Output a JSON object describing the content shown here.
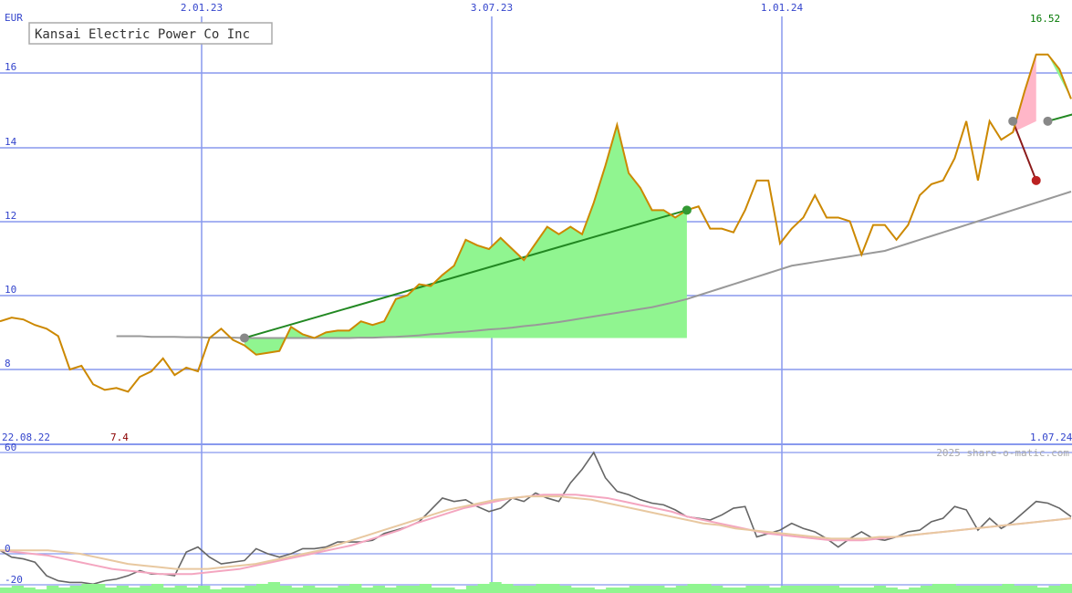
{
  "chart_data": [
    {
      "type": "line",
      "title": "Kansai Electric Power Co Inc",
      "currency_label": "EUR",
      "last_value_label": "16.52",
      "min_value_label": "7.4",
      "start_date_label": "22.08.22",
      "end_date_label": "1.07.24",
      "x_tick_labels": [
        "2.01.23",
        "3.07.23",
        "1.01.24"
      ],
      "y_tick_labels": [
        "16",
        "14",
        "12",
        "10",
        "8"
      ],
      "ylim": [
        7.0,
        16.8
      ],
      "grid": true,
      "colors": {
        "price": "#cc8800",
        "moving_average": "#999999",
        "trend_line": "#228822",
        "gain_fill": "#90f590",
        "loss_fill": "#ffb6c8",
        "grid": "#8899ee"
      },
      "series": [
        {
          "values": [
            9.3,
            9.4,
            9.35,
            9.2,
            9.1,
            8.9,
            8.0,
            8.1,
            7.6,
            7.45,
            7.5,
            7.4,
            7.8,
            7.95,
            8.3,
            7.85,
            8.05,
            7.95,
            8.85,
            9.1,
            8.8,
            8.65,
            8.4,
            8.45,
            8.5,
            9.15,
            8.95,
            8.85,
            9.0,
            9.05,
            9.05,
            9.3,
            9.2,
            9.3,
            9.9,
            10.0,
            10.3,
            10.25,
            10.55,
            10.8,
            11.5,
            11.35,
            11.25,
            11.55,
            11.25,
            10.95,
            11.4,
            11.85,
            11.65,
            11.85,
            11.65,
            12.5,
            13.5,
            14.6,
            13.3,
            12.9,
            12.3,
            12.3,
            12.1,
            12.3,
            12.4,
            11.8,
            11.8,
            11.7,
            12.3,
            13.1,
            13.1,
            11.4,
            11.8,
            12.1,
            12.7,
            12.1,
            12.1,
            12.0,
            11.1,
            11.9,
            11.9,
            11.5,
            11.9,
            12.7,
            13.0,
            13.1,
            13.7,
            14.7,
            13.1,
            14.7,
            14.2,
            14.4,
            15.5,
            16.5,
            16.5,
            16.1,
            15.3
          ]
        },
        {
          "values": [
            8.9,
            8.9,
            8.9,
            8.88,
            8.88,
            8.88,
            8.87,
            8.87,
            8.86,
            8.86,
            8.86,
            8.85,
            8.85,
            8.85,
            8.85,
            8.85,
            8.85,
            8.85,
            8.85,
            8.85,
            8.85,
            8.86,
            8.86,
            8.87,
            8.88,
            8.9,
            8.92,
            8.95,
            8.97,
            9.0,
            9.02,
            9.05,
            9.08,
            9.1,
            9.13,
            9.17,
            9.2,
            9.24,
            9.28,
            9.33,
            9.38,
            9.43,
            9.48,
            9.53,
            9.58,
            9.63,
            9.68,
            9.75,
            9.82,
            9.9,
            10.0,
            10.1,
            10.2,
            10.3,
            10.4,
            10.5,
            10.6,
            10.7,
            10.8,
            10.85,
            10.9,
            10.95,
            11.0,
            11.05,
            11.1,
            11.15,
            11.2,
            11.3,
            11.4,
            11.5,
            11.6,
            11.7,
            11.8,
            11.9,
            12.0,
            12.1,
            12.2,
            12.3,
            12.4,
            12.5,
            12.6,
            12.7,
            12.8
          ]
        }
      ],
      "trend_segments": [
        {
          "from": [
            21,
            8.85
          ],
          "to": [
            59,
            12.3
          ],
          "direction": "up"
        },
        {
          "from": [
            87,
            14.7
          ],
          "to": [
            89,
            13.1
          ],
          "direction": "down"
        },
        {
          "from": [
            90,
            14.7
          ],
          "to": [
            97,
            15.3
          ],
          "direction": "up"
        }
      ]
    },
    {
      "type": "line",
      "y_tick_labels": [
        "60",
        "0",
        "-20"
      ],
      "ylim": [
        -22,
        62
      ],
      "watermark": "2025 share-o-matic.com",
      "series": [
        {
          "values": [
            2,
            -2,
            -3,
            -5,
            -13,
            -16,
            -17,
            -17,
            -18,
            -16,
            -15,
            -13,
            -10,
            -12,
            -12,
            -13,
            1,
            4,
            -2,
            -6,
            -5,
            -4,
            3,
            0,
            -2,
            0,
            3,
            3,
            4,
            7,
            7,
            7,
            8,
            12,
            14,
            16,
            19,
            26,
            33,
            31,
            32,
            28,
            25,
            27,
            33,
            31,
            36,
            33,
            31,
            42,
            50,
            60,
            45,
            37,
            35,
            32,
            30,
            29,
            26,
            22,
            21,
            20,
            23,
            27,
            28,
            10,
            12,
            14,
            18,
            15,
            13,
            9,
            4,
            9,
            13,
            9,
            8,
            10,
            13,
            14,
            19,
            21,
            28,
            26,
            14,
            21,
            15,
            19,
            25,
            31,
            30,
            27,
            22
          ]
        },
        {
          "values": [
            2,
            1,
            0,
            -1,
            -3,
            -5,
            -7,
            -9,
            -10,
            -11,
            -12,
            -12,
            -12,
            -11,
            -10,
            -9,
            -7,
            -5,
            -3,
            -1,
            1,
            3,
            5,
            8,
            11,
            14,
            18,
            21,
            24,
            27,
            29,
            31,
            33,
            34,
            35,
            35,
            35,
            34,
            33,
            31,
            29,
            27,
            25,
            22,
            20,
            18,
            16,
            14,
            12,
            11,
            10,
            9,
            8,
            8,
            8,
            9,
            10,
            11,
            12,
            13,
            14,
            15,
            16,
            17,
            18,
            19,
            20,
            21
          ]
        },
        {
          "values": [
            2,
            2,
            2,
            2,
            1,
            0,
            -2,
            -4,
            -6,
            -7,
            -8,
            -9,
            -9,
            -9,
            -8,
            -7,
            -6,
            -4,
            -2,
            0,
            2,
            5,
            8,
            11,
            14,
            17,
            20,
            23,
            26,
            28,
            30,
            32,
            33,
            34,
            34,
            34,
            33,
            32,
            30,
            28,
            26,
            24,
            22,
            20,
            18,
            17,
            15,
            14,
            13,
            12,
            11,
            10,
            9,
            9,
            9,
            10,
            10,
            11,
            12,
            13,
            14,
            15,
            16,
            17,
            18,
            19,
            20,
            21
          ]
        }
      ],
      "volume_bars": [
        3,
        4,
        3,
        2,
        4,
        3,
        4,
        5,
        5,
        3,
        4,
        3,
        4,
        5,
        3,
        4,
        3,
        4,
        2,
        3,
        3,
        4,
        5,
        6,
        4,
        3,
        4,
        3,
        3,
        4,
        5,
        3,
        4,
        3,
        4,
        4,
        5,
        3,
        3,
        2,
        4,
        5,
        6,
        5,
        4,
        4,
        5,
        5,
        4,
        3,
        3,
        2,
        3,
        3,
        4,
        4,
        4,
        3,
        4,
        5,
        5,
        4,
        3,
        3,
        4,
        4,
        3,
        4,
        4,
        4,
        4,
        4,
        3,
        3,
        3,
        4,
        3,
        2,
        3,
        4,
        5,
        5,
        4,
        4,
        4,
        4,
        5,
        4,
        4,
        3,
        4,
        5
      ]
    }
  ]
}
